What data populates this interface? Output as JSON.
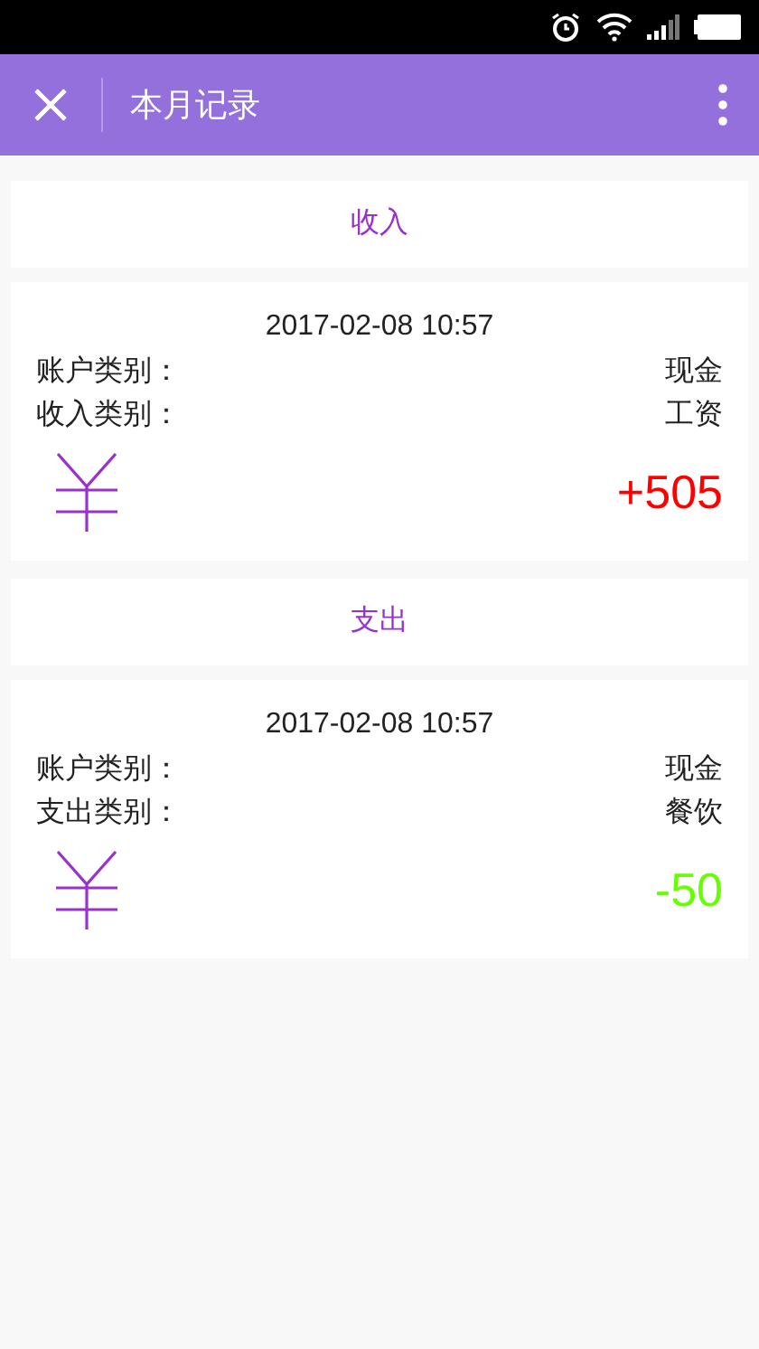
{
  "app_bar": {
    "title": "本月记录"
  },
  "sections": [
    {
      "heading": "收入",
      "records": [
        {
          "time": "2017-02-08 10:57",
          "fields": [
            {
              "label": "账户类别：",
              "value": "现金"
            },
            {
              "label": "收入类别：",
              "value": "工资"
            }
          ],
          "amount": "+505",
          "color": "#ff0000"
        }
      ]
    },
    {
      "heading": "支出",
      "records": [
        {
          "time": "2017-02-08 10:57",
          "fields": [
            {
              "label": "账户类别：",
              "value": "现金"
            },
            {
              "label": "支出类别：",
              "value": "餐饮"
            }
          ],
          "amount": "-50",
          "color": "#66ff00"
        }
      ]
    }
  ]
}
